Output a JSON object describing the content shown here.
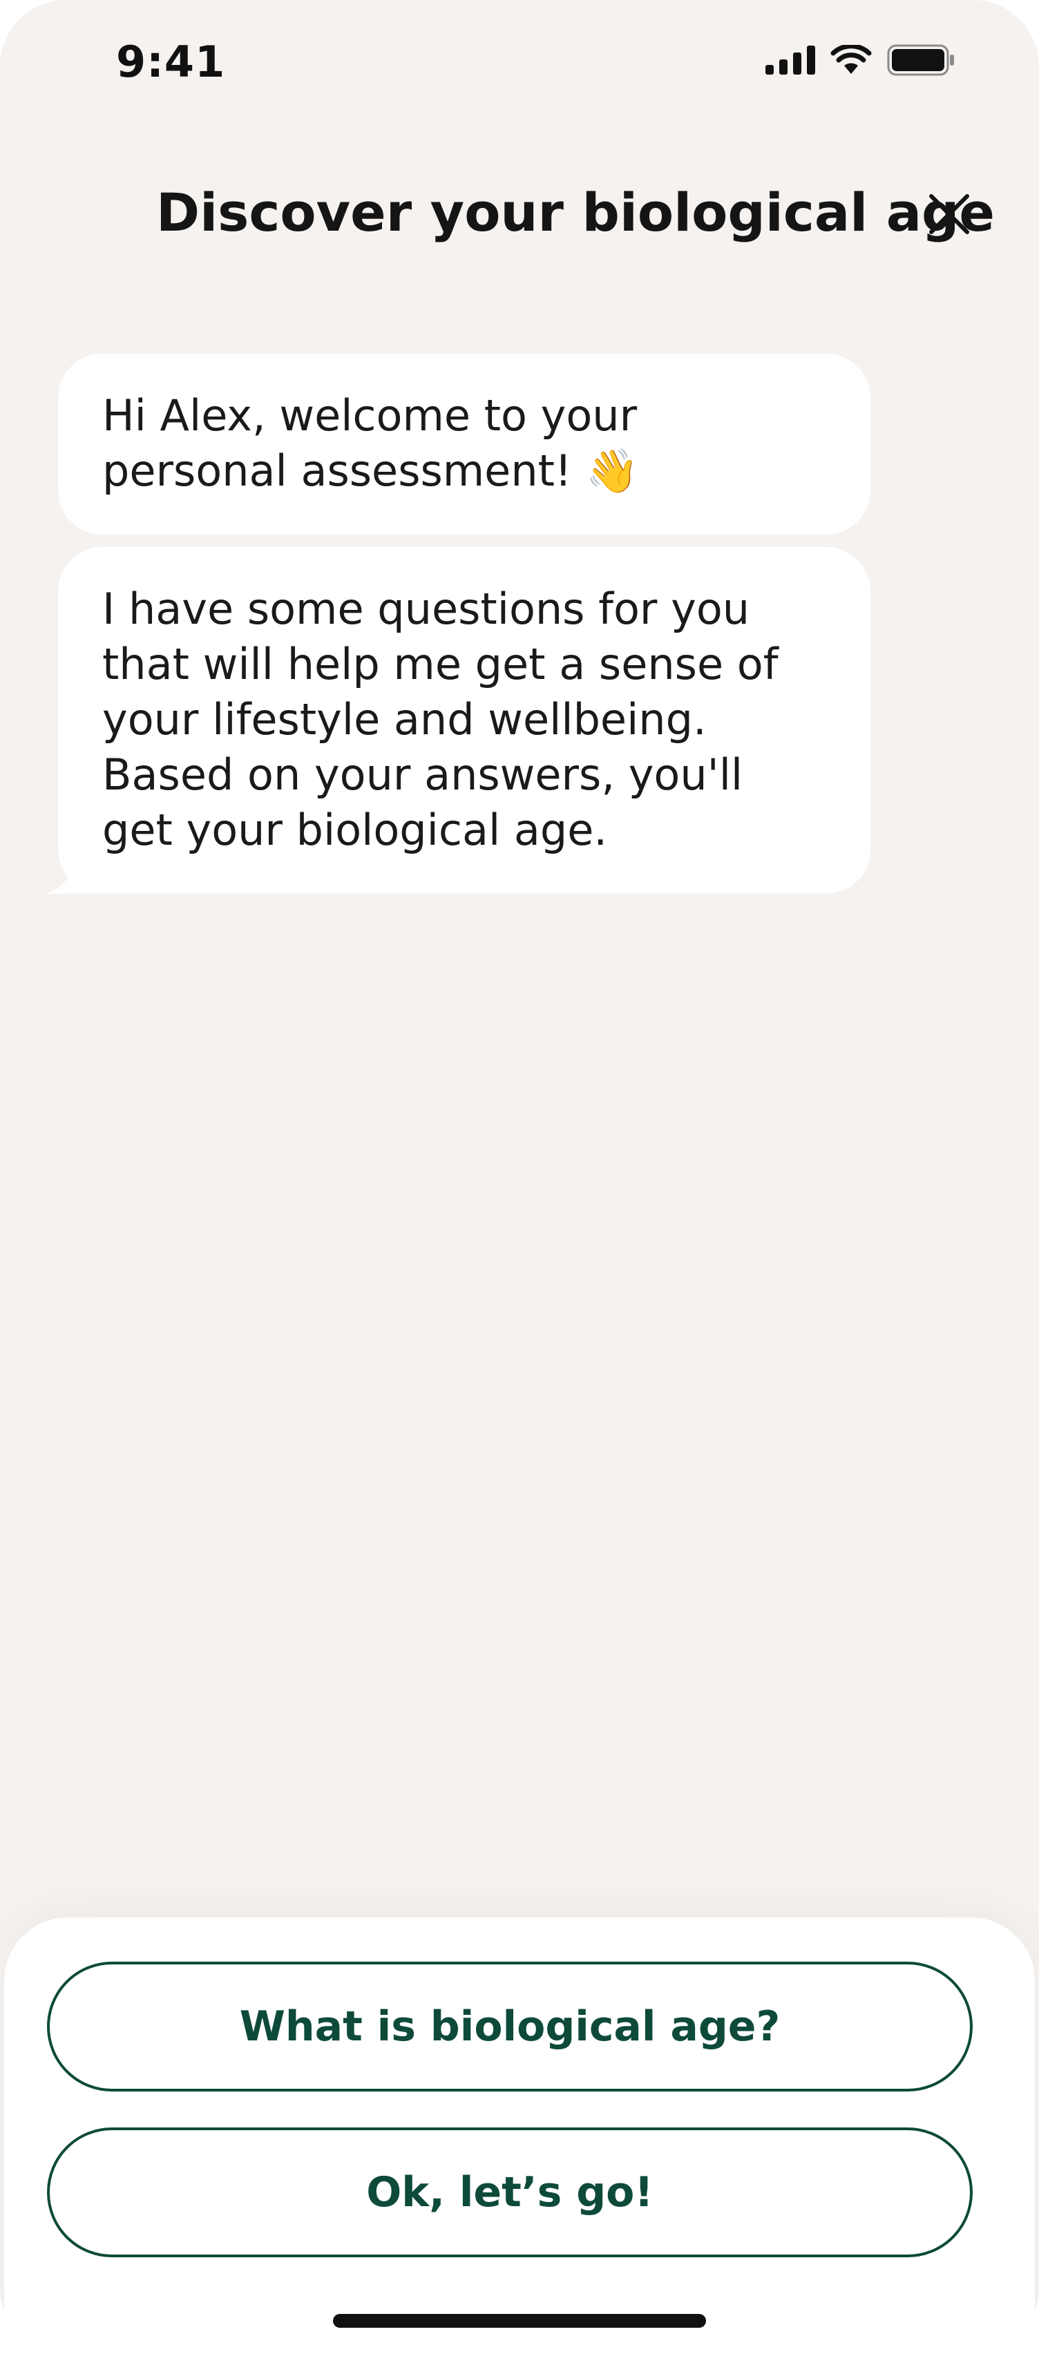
{
  "status_bar": {
    "time": "9:41",
    "icons": [
      "cellular-signal-icon",
      "wifi-icon",
      "battery-icon"
    ]
  },
  "header": {
    "title": "Discover your biological age",
    "close_icon": "close-icon"
  },
  "messages": [
    {
      "text": "Hi Alex, welcome to your personal assessment! 👋"
    },
    {
      "text": "I have some questions for you that will help me get a sense of your lifestyle and wellbeing. Based on your answers, you'll get your biological age."
    }
  ],
  "options": [
    {
      "label": "What is biological age?"
    },
    {
      "label": "Ok, let’s go!"
    }
  ],
  "colors": {
    "background": "#f5f2ef",
    "bubble": "#ffffff",
    "accent": "#0d4a3a",
    "text": "#1a1a1a"
  }
}
